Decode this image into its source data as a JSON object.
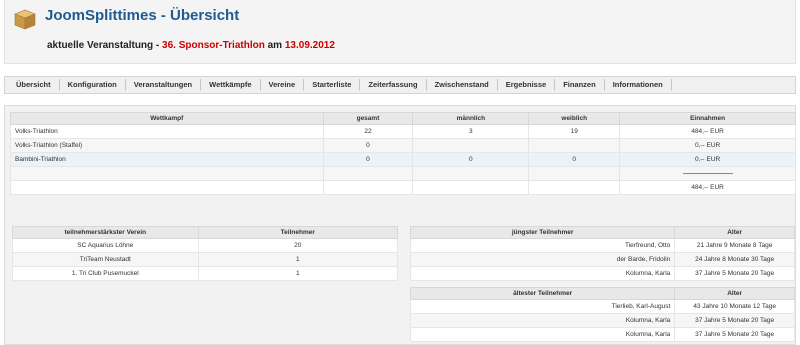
{
  "header": {
    "title": "JoomSplittimes - Übersicht",
    "event_prefix": "aktuelle Veranstaltung - ",
    "event_name": "36. Sponsor-Triathlon",
    "event_mid": " am ",
    "event_date": "13.09.2012"
  },
  "menu": [
    "Übersicht",
    "Konfiguration",
    "Veranstaltungen",
    "Wettkämpfe",
    "Vereine",
    "Starterliste",
    "Zeiterfassung",
    "Zwischenstand",
    "Ergebnisse",
    "Finanzen",
    "Informationen"
  ],
  "competitions": {
    "headers": [
      "Wettkampf",
      "gesamt",
      "männlich",
      "weiblich",
      "Einnahmen"
    ],
    "rows": [
      {
        "name": "Volks-Triathlon",
        "total": "22",
        "male": "3",
        "female": "19",
        "income": "484,-- EUR"
      },
      {
        "name": "Volks-Triathlon (Staffel)",
        "total": "0",
        "male": "",
        "female": "",
        "income": "0,-- EUR"
      },
      {
        "name": "Bambini-Triathlon",
        "total": "0",
        "male": "0",
        "female": "0",
        "income": "0,-- EUR"
      }
    ],
    "total_income": "484,-- EUR"
  },
  "clubs": {
    "headers": [
      "teilnehmerstärkster Verein",
      "Teilnehmer"
    ],
    "rows": [
      {
        "name": "SC Aquarius Löhne",
        "count": "20"
      },
      {
        "name": "TriTeam Neustadt",
        "count": "1"
      },
      {
        "name": "1. Tri Club Pusemuckel",
        "count": "1"
      }
    ]
  },
  "youngest": {
    "headers": [
      "jüngster Teilnehmer",
      "Alter"
    ],
    "rows": [
      {
        "name": "Tierfreund, Otto",
        "age": "21 Jahre 9 Monate 8 Tage"
      },
      {
        "name": "der Barde, Fridolin",
        "age": "24 Jahre 8 Monate 30 Tage"
      },
      {
        "name": "Kolumna, Karla",
        "age": "37 Jahre 5 Monate 20 Tage"
      }
    ]
  },
  "oldest": {
    "headers": [
      "ältester Teilnehmer",
      "Alter"
    ],
    "rows": [
      {
        "name": "Tierlieb, Karl-August",
        "age": "43 Jahre 10 Monate 12 Tage"
      },
      {
        "name": "Kolumna, Karla",
        "age": "37 Jahre 5 Monate 20 Tage"
      },
      {
        "name": "Kolumna, Karla",
        "age": "37 Jahre 5 Monate 20 Tage"
      }
    ]
  },
  "colors": {
    "title": "#1f5b91",
    "event_highlight": "#cc0000",
    "row_highlight": "#e8f3fa"
  },
  "icons": {
    "logo": "box-icon"
  }
}
